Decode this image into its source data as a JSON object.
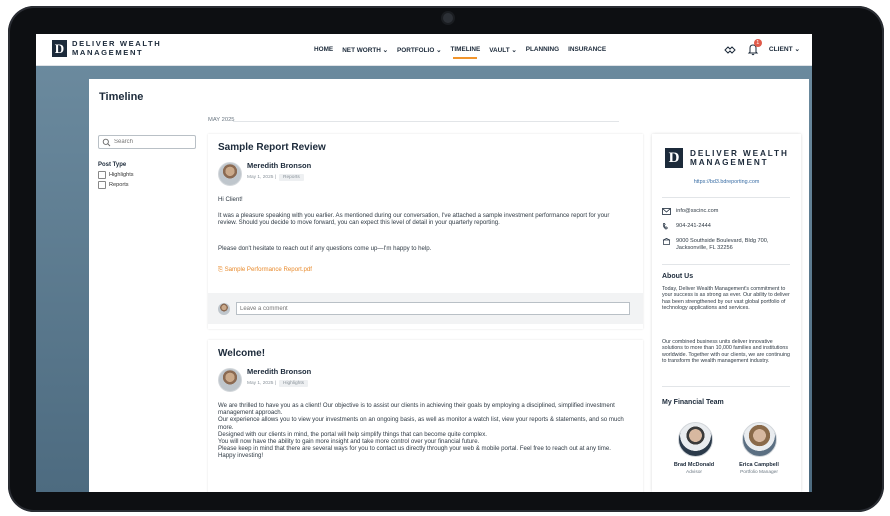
{
  "brand": {
    "mark": "D",
    "line1": "DELIVER WEALTH",
    "line2": "MANAGEMENT"
  },
  "nav": {
    "items": [
      {
        "label": "HOME"
      },
      {
        "label": "NET WORTH ⌄"
      },
      {
        "label": "PORTFOLIO ⌄"
      },
      {
        "label": "TIMELINE"
      },
      {
        "label": "VAULT ⌄"
      },
      {
        "label": "PLANNING"
      },
      {
        "label": "INSURANCE"
      }
    ],
    "active": "TIMELINE",
    "notification_count": "1",
    "client_label": "CLIENT ⌄",
    "accent_color": "#f0942c"
  },
  "page": {
    "title": "Timeline",
    "month": "MAY 2025"
  },
  "filters": {
    "search_placeholder": "Search",
    "post_type_label": "Post Type",
    "options": [
      {
        "label": "Highlights"
      },
      {
        "label": "Reports"
      }
    ]
  },
  "posts": [
    {
      "title": "Sample Report Review",
      "author": "Meredith Bronson",
      "date": "May 1, 2025 |",
      "tag": "Reports",
      "paragraphs": [
        "Hi Client!",
        "It was a pleasure speaking with you earlier. As mentioned during our conversation, I've attached a sample investment performance report for your review. Should you decide to move forward, you can expect this level of detail in your quarterly reporting.",
        "Please don't hesitate to reach out if any questions come up—I'm happy to help."
      ],
      "attachment": "Sample Performance Report.pdf",
      "comment_placeholder": "Leave a comment"
    },
    {
      "title": "Welcome!",
      "author": "Meredith Bronson",
      "date": "May 1, 2025 |",
      "tag": "Highlights",
      "body": "We are thrilled to have you as a client! Our objective is to assist our clients in achieving their goals by employing a disciplined, simplified investment management approach.\nOur experience allows you to view your investments on an ongoing basis, as well as monitor a watch list, view your reports & statements, and so much more.\nDesigned with our clients in mind, the portal will help simplify things that can become quite complex.\nYou will now have the ability to gain more insight and take more control over your financial future.\nPlease keep in mind that there are several ways for you to contact us directly through your web & mobile portal. Feel free to reach out at any time. Happy investing!"
    }
  ],
  "sidebar": {
    "website": "https://bd3.bdreporting.com",
    "email": "info@sscinc.com",
    "phone": "904-241-2444",
    "address_line1": "9000 Southside Boulevard, Bldg 700,",
    "address_line2": "Jacksonville, FL 32256",
    "about_heading": "About Us",
    "about_p1": "Today, Deliver Wealth Management's commitment to your success is as strong as ever. Our ability to deliver has been strengthened by our vast global portfolio of technology applications and services.",
    "about_p2": "Our combined business units deliver innovative solutions to more than 10,000 families and institutions worldwide. Together with our clients, we are continuing to transform the wealth management industry.",
    "team_heading": "My Financial Team",
    "team": [
      {
        "name": "Brad McDonald",
        "role": "Advisor"
      },
      {
        "name": "Erica Campbell",
        "role": "Portfolio Manager"
      }
    ]
  }
}
